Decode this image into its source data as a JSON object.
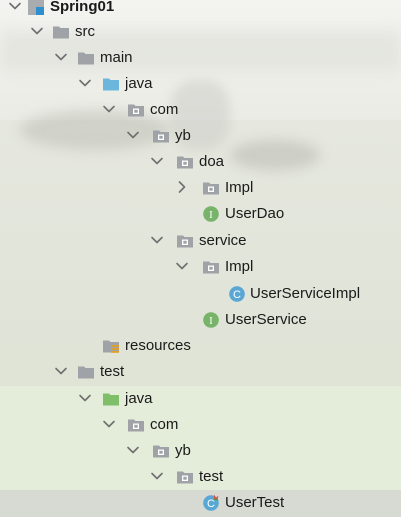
{
  "tree": {
    "items": [
      {
        "label": "Spring01"
      },
      {
        "label": "src"
      },
      {
        "label": "main"
      },
      {
        "label": "java"
      },
      {
        "label": "com"
      },
      {
        "label": "yb"
      },
      {
        "label": "doa"
      },
      {
        "label": "Impl"
      },
      {
        "label": "UserDao"
      },
      {
        "label": "service"
      },
      {
        "label": "Impl"
      },
      {
        "label": "UserServiceImpl"
      },
      {
        "label": "UserService"
      },
      {
        "label": "resources"
      },
      {
        "label": "test"
      },
      {
        "label": "java"
      },
      {
        "label": "com"
      },
      {
        "label": "yb"
      },
      {
        "label": "test"
      },
      {
        "label": "UserTest"
      }
    ]
  },
  "icons": {
    "interface_letter": "I",
    "class_letter": "C"
  },
  "colors": {
    "folder": "#9fa2a6",
    "source_folder": "#6bb6dd",
    "test_folder": "#7fbf6a",
    "interface_badge": "#78b36a",
    "class_badge": "#5aa7d6",
    "arrow": "#6f6f6f"
  }
}
